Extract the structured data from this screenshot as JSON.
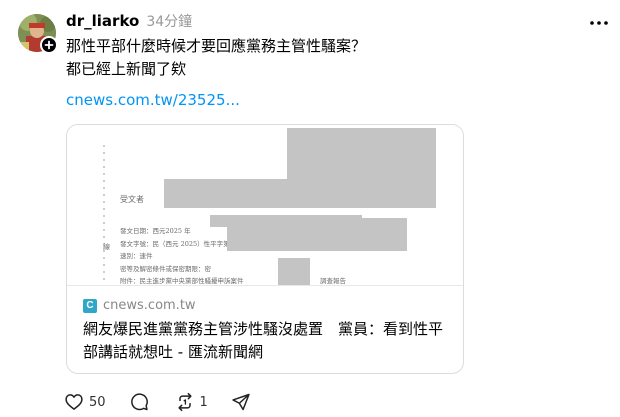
{
  "post": {
    "username": "dr_liarko",
    "timestamp": "34分鐘",
    "text_lines": [
      "那性平部什麼時候才要回應黨務主管性騷案？",
      "都已經上新聞了欸"
    ],
    "link_text": "cnews.com.tw/23525..."
  },
  "card": {
    "favicon_letter": "C",
    "domain": "cnews.com.tw",
    "title": "網友爆民進黨黨務主管涉性騷沒處置　黨員：看到性平部講話就想吐 - 匯流新聞網",
    "document": {
      "recipient": "受文者",
      "side_mark": "線",
      "lines": [
        "發文日期：西元2025 年",
        "發文字號：民（西元 2025）性平字第",
        "速別：速件",
        "密等及解密條件或保密期限：密",
        "附件：民主進步黨中央黨部性騷擾申訴案件",
        "調查報告"
      ]
    }
  },
  "actions": {
    "likes": "50",
    "reposts": "1"
  },
  "colors": {
    "link": "#0095f6",
    "muted": "#999999",
    "redaction": "#c4c4c4"
  },
  "icons": [
    "avatar",
    "plus-icon",
    "more-icon",
    "heart-icon",
    "comment-icon",
    "repost-icon",
    "share-icon"
  ]
}
